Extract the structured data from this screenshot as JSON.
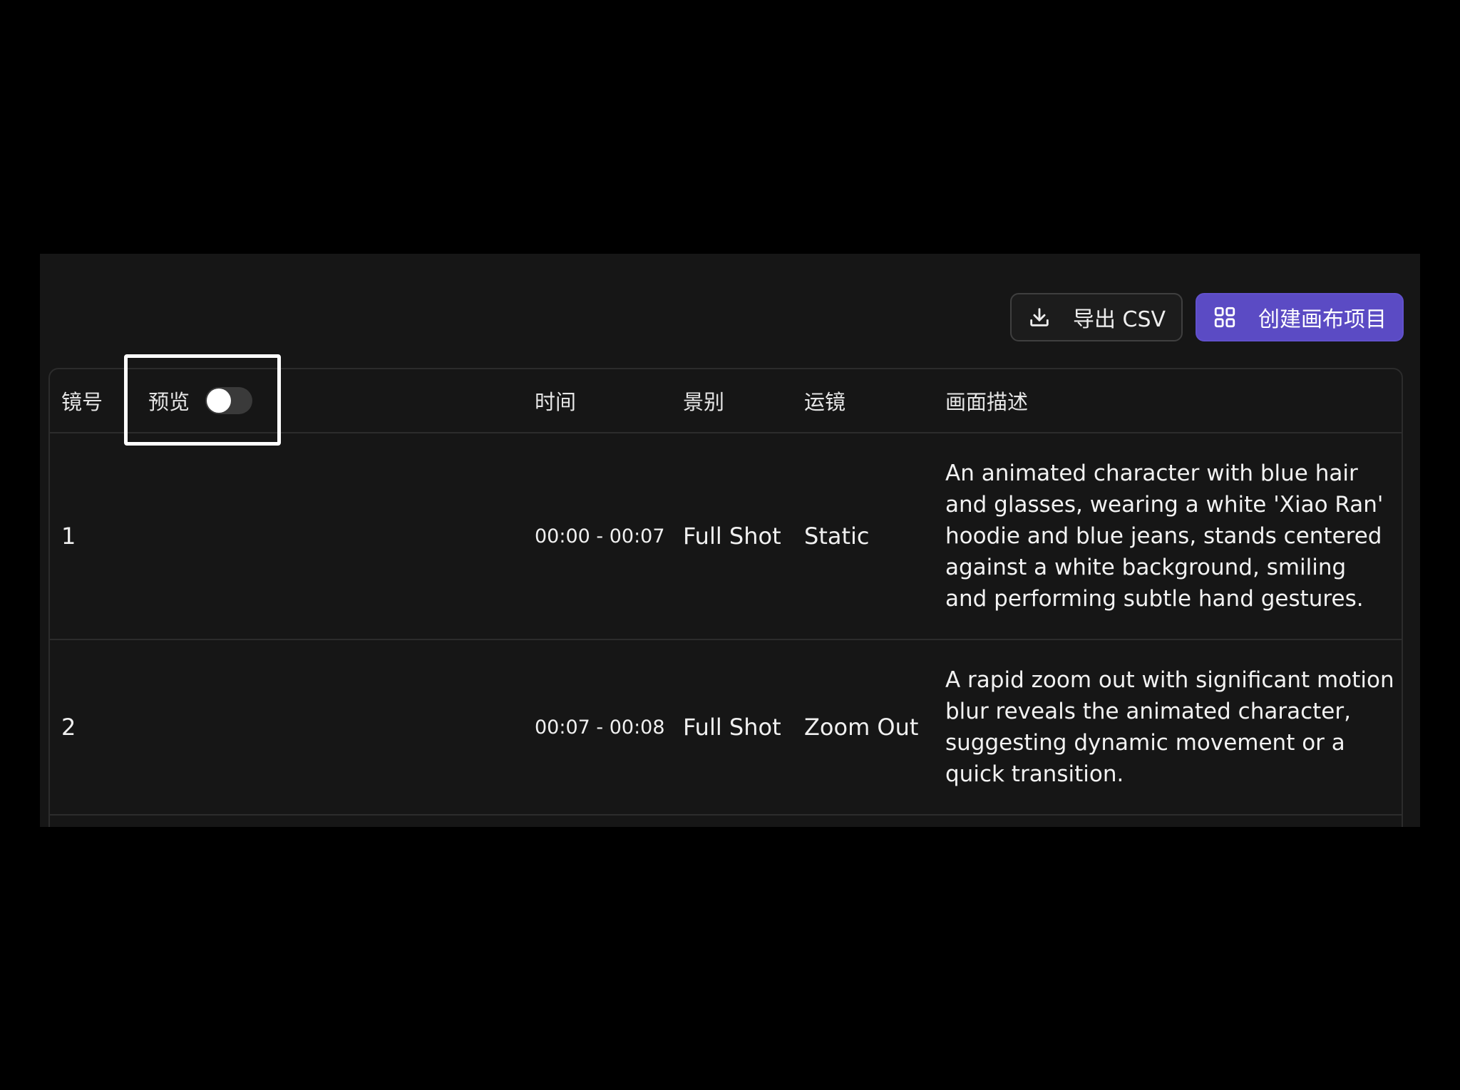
{
  "toolbar": {
    "export_label": "导出 CSV",
    "export_icon": "download-icon",
    "create_label": "创建画布项目",
    "create_icon": "grid-icon",
    "create_color": "#5b4bc4"
  },
  "table": {
    "headers": {
      "shot_no": "镜号",
      "preview": "预览",
      "time": "时间",
      "shot_size": "景别",
      "camera_move": "运镜",
      "description": "画面描述"
    },
    "preview_toggle_on": false,
    "rows": [
      {
        "no": "1",
        "time": "00:00 - 00:07",
        "shot_size": "Full Shot",
        "camera_move": "Static",
        "description": "An animated character with blue hair and glasses, wearing a white 'Xiao Ran' hoodie and blue jeans, stands centered against a white background, smiling and performing subtle hand gestures."
      },
      {
        "no": "2",
        "time": "00:07 - 00:08",
        "shot_size": "Full Shot",
        "camera_move": "Zoom Out",
        "description": "A rapid zoom out with significant motion blur reveals the animated character, suggesting dynamic movement or a quick transition."
      }
    ]
  }
}
